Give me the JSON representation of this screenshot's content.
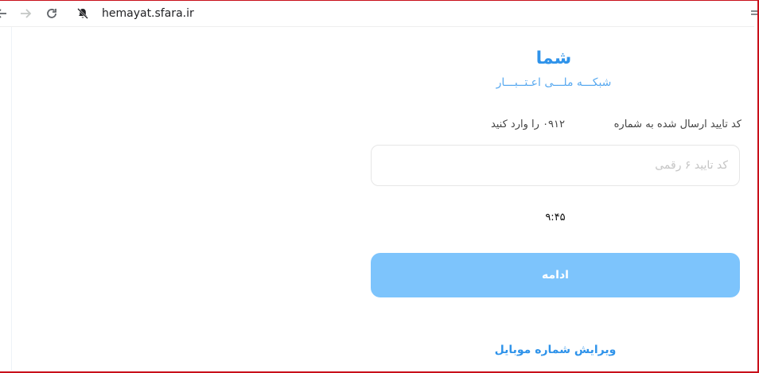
{
  "browser": {
    "url": "hemayat.sfara.ir",
    "icons": [
      "back-arrow-icon",
      "forward-arrow-icon",
      "reload-icon",
      "notifications-off-icon"
    ]
  },
  "brand": {
    "title": "شما",
    "subtitle": "شبکـــه ملـــی اعـتــبـــار"
  },
  "verify": {
    "message": "کد تایید ارسال شده به شماره",
    "phone_prefix": "۰۹۱۲",
    "message_suffix": "را وارد کنید",
    "input_placeholder": "کد تایید ۶ رقمی",
    "input_value": "",
    "timer": "۹:۴۵",
    "continue_label": "ادامه",
    "edit_mobile_label": "ویرایش شماره موبایل"
  },
  "colors": {
    "brand": "#2f93ea",
    "button": "#7dc4fc",
    "frame": "#c8101a"
  }
}
